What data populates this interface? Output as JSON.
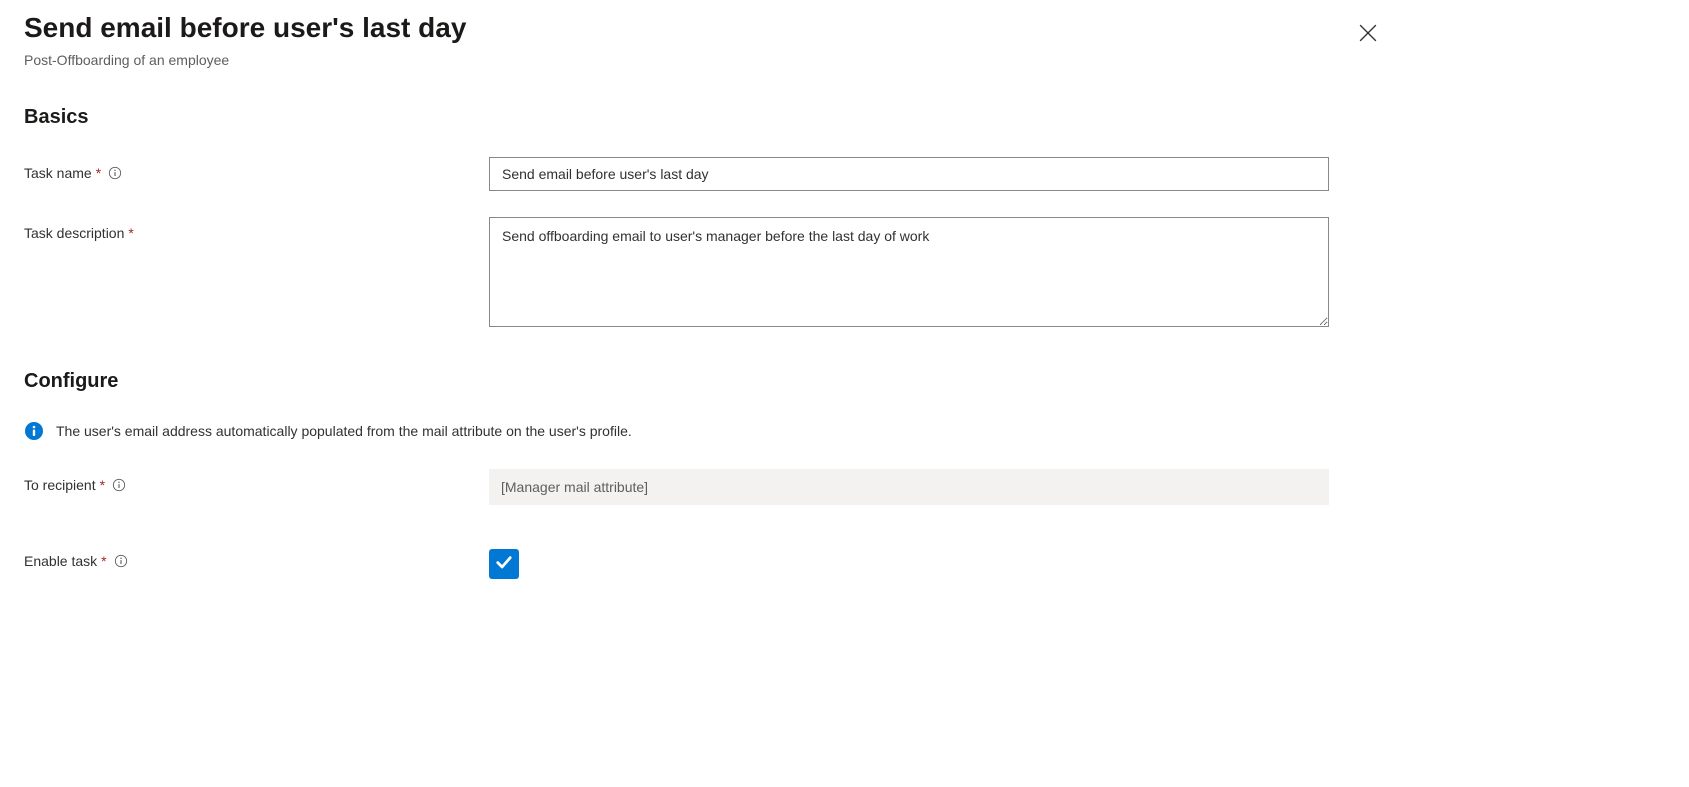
{
  "header": {
    "title": "Send email before user's last day",
    "subtitle": "Post-Offboarding of an employee"
  },
  "sections": {
    "basics": {
      "heading": "Basics",
      "task_name": {
        "label": "Task name",
        "value": "Send email before user's last day"
      },
      "task_description": {
        "label": "Task description",
        "value": "Send offboarding email to user's manager before the last day of work"
      }
    },
    "configure": {
      "heading": "Configure",
      "info_message": "The user's email address automatically populated from the mail attribute on the user's profile.",
      "to_recipient": {
        "label": "To recipient",
        "value": "[Manager mail attribute]"
      },
      "enable_task": {
        "label": "Enable task",
        "checked": true
      }
    }
  },
  "required_marker": "*"
}
